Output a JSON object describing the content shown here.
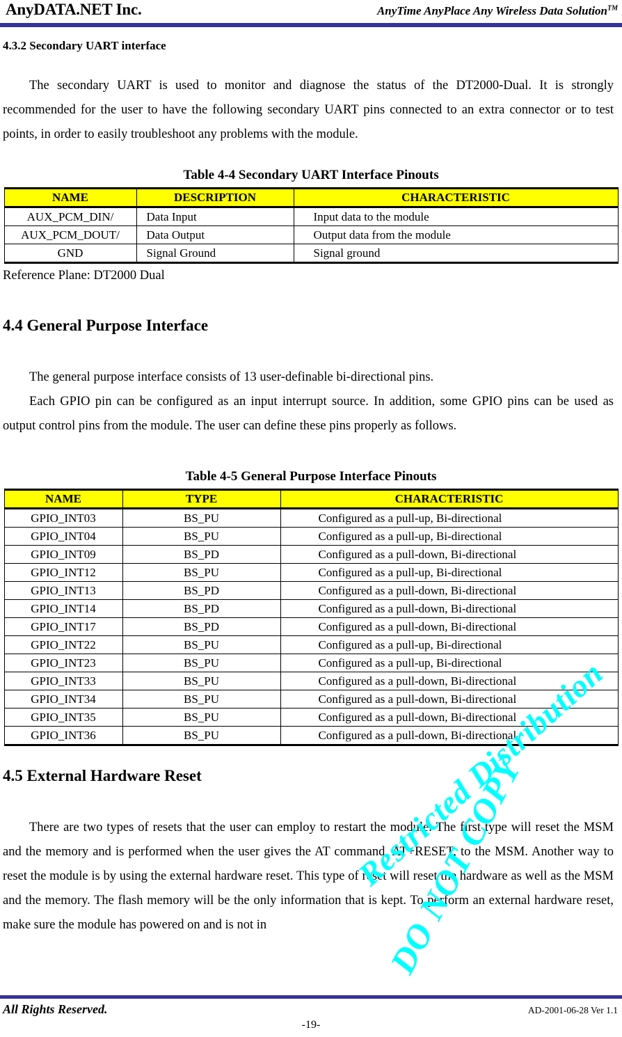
{
  "header": {
    "company": "AnyDATA.NET Inc.",
    "tagline": "AnyTime AnyPlace Any Wireless Data Solution",
    "tagline_sup": "TM",
    "rule_color": "#333399"
  },
  "sections": {
    "s432": {
      "heading": "4.3.2 Secondary UART interface",
      "paragraph": "The secondary UART is used to monitor and diagnose the status of the DT2000-Dual.    It is strongly recommended for the user to have the following secondary UART pins connected to an extra connector or to test points, in order to easily troubleshoot any problems with the module.",
      "reference_plane": "Reference Plane: DT2000 Dual"
    },
    "s44": {
      "heading": "4.4 General Purpose Interface",
      "paragraph_1": "The general purpose interface consists of 13 user-definable bi-directional pins.",
      "paragraph_2": "Each GPIO pin can be configured as an input interrupt source. In addition, some GPIO pins can be used as output control pins from the module. The user can define these pins properly as follows."
    },
    "s45": {
      "heading": "4.5 External Hardware Reset",
      "paragraph": "There are two types of resets that the user can employ to restart the module. The first type will reset the MSM and the memory and is performed when the user gives the AT command, AT+RESET, to the MSM. Another way to reset the module is by using the external hardware reset. This type of reset will reset the hardware as well as the MSM and the memory. The flash memory will be the only information that is kept. To perform an external hardware reset, make sure the module has powered on and is not in"
    }
  },
  "table_44": {
    "caption": "Table 4-4 Secondary UART Interface Pinouts",
    "header_bg": "#ffff00",
    "columns": [
      "NAME",
      "DESCRIPTION",
      "CHARACTERISTIC"
    ],
    "rows": [
      [
        "AUX_PCM_DIN/",
        "Data Input",
        "Input data to the module"
      ],
      [
        "AUX_PCM_DOUT/",
        "Data Output",
        "Output data from the module"
      ],
      [
        "GND",
        "Signal Ground",
        "Signal ground"
      ]
    ]
  },
  "table_45": {
    "caption": "Table 4-5 General Purpose Interface Pinouts",
    "header_bg": "#ffff00",
    "columns": [
      "NAME",
      "TYPE",
      "CHARACTERISTIC"
    ],
    "rows": [
      [
        "GPIO_INT03",
        "BS_PU",
        "Configured as a pull-up, Bi-directional"
      ],
      [
        "GPIO_INT04",
        "BS_PU",
        "Configured as a pull-up, Bi-directional"
      ],
      [
        "GPIO_INT09",
        "BS_PD",
        "Configured as a pull-down, Bi-directional"
      ],
      [
        "GPIO_INT12",
        "BS_PU",
        "Configured as a pull-up, Bi-directional"
      ],
      [
        "GPIO_INT13",
        "BS_PD",
        "Configured as a pull-down, Bi-directional"
      ],
      [
        "GPIO_INT14",
        "BS_PD",
        "Configured as a pull-down, Bi-directional"
      ],
      [
        "GPIO_INT17",
        "BS_PD",
        "Configured as a pull-down, Bi-directional"
      ],
      [
        "GPIO_INT22",
        "BS_PU",
        "Configured as a pull-up, Bi-directional"
      ],
      [
        "GPIO_INT23",
        "BS_PU",
        "Configured as a pull-up, Bi-directional"
      ],
      [
        "GPIO_INT33",
        "BS_PU",
        "Configured as a pull-down, Bi-directional"
      ],
      [
        "GPIO_INT34",
        "BS_PU",
        "Configured as a pull-down, Bi-directional"
      ],
      [
        "GPIO_INT35",
        "BS_PU",
        "Configured as a pull-down, Bi-directional"
      ],
      [
        "GPIO_INT36",
        "BS_PU",
        "Configured as a pull-down, Bi-directional"
      ]
    ]
  },
  "watermark": {
    "line_1": "Restricted Distribution",
    "line_2": "DO NOT COPY",
    "color": "#00ffff"
  },
  "footer": {
    "left": "All Rights Reserved.",
    "page_number": "-19-",
    "right": "AD-2001-06-28 Ver 1.1",
    "rule_color": "#333399"
  }
}
